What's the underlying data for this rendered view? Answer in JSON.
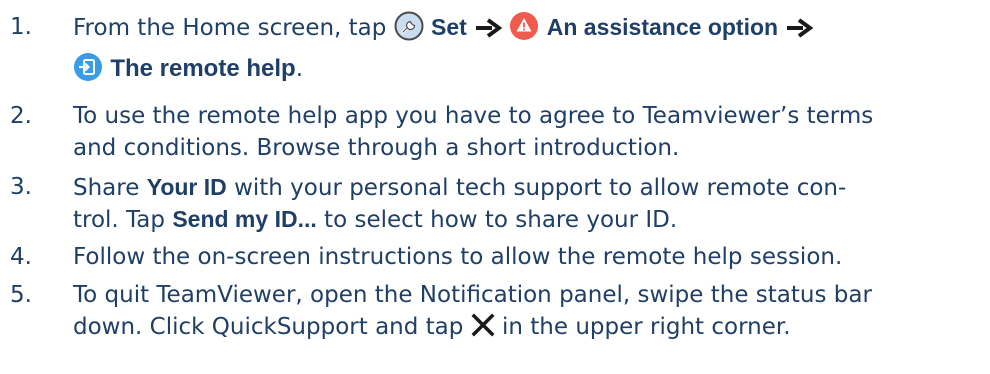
{
  "colors": {
    "text": "#1f3f66",
    "wrench_icon_bg": "#c9ddef",
    "warning_icon_bg": "#ef5b4c",
    "exit_icon_bg": "#3a9be6"
  },
  "icons": [
    "wrench-icon",
    "warning-icon",
    "exit-icon",
    "arrow-right-icon",
    "close-x-icon"
  ],
  "steps": [
    {
      "number": "1.",
      "line1_a": "From the Home screen, tap ",
      "set": "Set",
      "assistance": "An assistance option",
      "remote_help": "The remote help",
      "period": "."
    },
    {
      "number": "2.",
      "line1": "To use the remote help app you have to agree to Teamviewer’s terms",
      "line2": "and conditions. Browse through a short introduction."
    },
    {
      "number": "3.",
      "line1_a": "Share ",
      "your_id": "Your ID",
      "line1_b": " with your personal tech support to allow remote con-",
      "line2_a": "trol. Tap ",
      "send_id": "Send my ID...",
      "line2_b": " to select how to share your ID."
    },
    {
      "number": "4.",
      "line1": "Follow the on-screen instructions to allow the remote help session."
    },
    {
      "number": "5.",
      "line1": "To quit TeamViewer, open the Notification panel, swipe the status bar",
      "line2_a": "down. Click QuickSupport and tap ",
      "line2_b": " in the upper right corner."
    }
  ]
}
